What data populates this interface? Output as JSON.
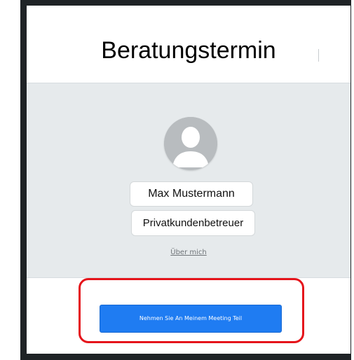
{
  "header": {
    "title": "Beratungstermin"
  },
  "advisor": {
    "avatar_icon": "user-avatar-icon",
    "name": "Max Mustermann",
    "role": "Privatkundenbetreuer",
    "about_link": "Über mich"
  },
  "footer": {
    "cta_label": "Nehmen Sie An Meinem Meeting Teil"
  },
  "annotation": {
    "color": "#e5141b"
  },
  "colors": {
    "accent": "#1f7cf2",
    "background": "#e6eaec"
  }
}
